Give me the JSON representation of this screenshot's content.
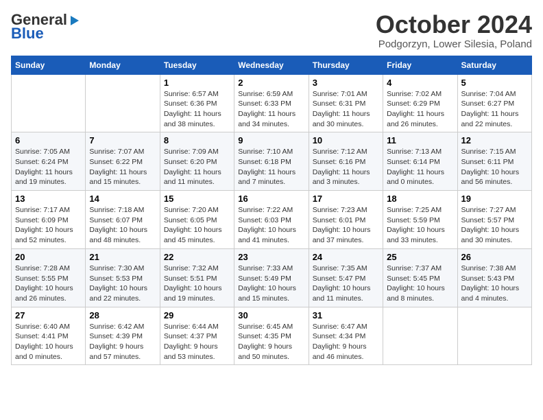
{
  "header": {
    "logo_general": "General",
    "logo_blue": "Blue",
    "month_title": "October 2024",
    "subtitle": "Podgorzyn, Lower Silesia, Poland"
  },
  "days_of_week": [
    "Sunday",
    "Monday",
    "Tuesday",
    "Wednesday",
    "Thursday",
    "Friday",
    "Saturday"
  ],
  "weeks": [
    [
      {
        "day": "",
        "info": ""
      },
      {
        "day": "",
        "info": ""
      },
      {
        "day": "1",
        "info": "Sunrise: 6:57 AM\nSunset: 6:36 PM\nDaylight: 11 hours and 38 minutes."
      },
      {
        "day": "2",
        "info": "Sunrise: 6:59 AM\nSunset: 6:33 PM\nDaylight: 11 hours and 34 minutes."
      },
      {
        "day": "3",
        "info": "Sunrise: 7:01 AM\nSunset: 6:31 PM\nDaylight: 11 hours and 30 minutes."
      },
      {
        "day": "4",
        "info": "Sunrise: 7:02 AM\nSunset: 6:29 PM\nDaylight: 11 hours and 26 minutes."
      },
      {
        "day": "5",
        "info": "Sunrise: 7:04 AM\nSunset: 6:27 PM\nDaylight: 11 hours and 22 minutes."
      }
    ],
    [
      {
        "day": "6",
        "info": "Sunrise: 7:05 AM\nSunset: 6:24 PM\nDaylight: 11 hours and 19 minutes."
      },
      {
        "day": "7",
        "info": "Sunrise: 7:07 AM\nSunset: 6:22 PM\nDaylight: 11 hours and 15 minutes."
      },
      {
        "day": "8",
        "info": "Sunrise: 7:09 AM\nSunset: 6:20 PM\nDaylight: 11 hours and 11 minutes."
      },
      {
        "day": "9",
        "info": "Sunrise: 7:10 AM\nSunset: 6:18 PM\nDaylight: 11 hours and 7 minutes."
      },
      {
        "day": "10",
        "info": "Sunrise: 7:12 AM\nSunset: 6:16 PM\nDaylight: 11 hours and 3 minutes."
      },
      {
        "day": "11",
        "info": "Sunrise: 7:13 AM\nSunset: 6:14 PM\nDaylight: 11 hours and 0 minutes."
      },
      {
        "day": "12",
        "info": "Sunrise: 7:15 AM\nSunset: 6:11 PM\nDaylight: 10 hours and 56 minutes."
      }
    ],
    [
      {
        "day": "13",
        "info": "Sunrise: 7:17 AM\nSunset: 6:09 PM\nDaylight: 10 hours and 52 minutes."
      },
      {
        "day": "14",
        "info": "Sunrise: 7:18 AM\nSunset: 6:07 PM\nDaylight: 10 hours and 48 minutes."
      },
      {
        "day": "15",
        "info": "Sunrise: 7:20 AM\nSunset: 6:05 PM\nDaylight: 10 hours and 45 minutes."
      },
      {
        "day": "16",
        "info": "Sunrise: 7:22 AM\nSunset: 6:03 PM\nDaylight: 10 hours and 41 minutes."
      },
      {
        "day": "17",
        "info": "Sunrise: 7:23 AM\nSunset: 6:01 PM\nDaylight: 10 hours and 37 minutes."
      },
      {
        "day": "18",
        "info": "Sunrise: 7:25 AM\nSunset: 5:59 PM\nDaylight: 10 hours and 33 minutes."
      },
      {
        "day": "19",
        "info": "Sunrise: 7:27 AM\nSunset: 5:57 PM\nDaylight: 10 hours and 30 minutes."
      }
    ],
    [
      {
        "day": "20",
        "info": "Sunrise: 7:28 AM\nSunset: 5:55 PM\nDaylight: 10 hours and 26 minutes."
      },
      {
        "day": "21",
        "info": "Sunrise: 7:30 AM\nSunset: 5:53 PM\nDaylight: 10 hours and 22 minutes."
      },
      {
        "day": "22",
        "info": "Sunrise: 7:32 AM\nSunset: 5:51 PM\nDaylight: 10 hours and 19 minutes."
      },
      {
        "day": "23",
        "info": "Sunrise: 7:33 AM\nSunset: 5:49 PM\nDaylight: 10 hours and 15 minutes."
      },
      {
        "day": "24",
        "info": "Sunrise: 7:35 AM\nSunset: 5:47 PM\nDaylight: 10 hours and 11 minutes."
      },
      {
        "day": "25",
        "info": "Sunrise: 7:37 AM\nSunset: 5:45 PM\nDaylight: 10 hours and 8 minutes."
      },
      {
        "day": "26",
        "info": "Sunrise: 7:38 AM\nSunset: 5:43 PM\nDaylight: 10 hours and 4 minutes."
      }
    ],
    [
      {
        "day": "27",
        "info": "Sunrise: 6:40 AM\nSunset: 4:41 PM\nDaylight: 10 hours and 0 minutes."
      },
      {
        "day": "28",
        "info": "Sunrise: 6:42 AM\nSunset: 4:39 PM\nDaylight: 9 hours and 57 minutes."
      },
      {
        "day": "29",
        "info": "Sunrise: 6:44 AM\nSunset: 4:37 PM\nDaylight: 9 hours and 53 minutes."
      },
      {
        "day": "30",
        "info": "Sunrise: 6:45 AM\nSunset: 4:35 PM\nDaylight: 9 hours and 50 minutes."
      },
      {
        "day": "31",
        "info": "Sunrise: 6:47 AM\nSunset: 4:34 PM\nDaylight: 9 hours and 46 minutes."
      },
      {
        "day": "",
        "info": ""
      },
      {
        "day": "",
        "info": ""
      }
    ]
  ]
}
